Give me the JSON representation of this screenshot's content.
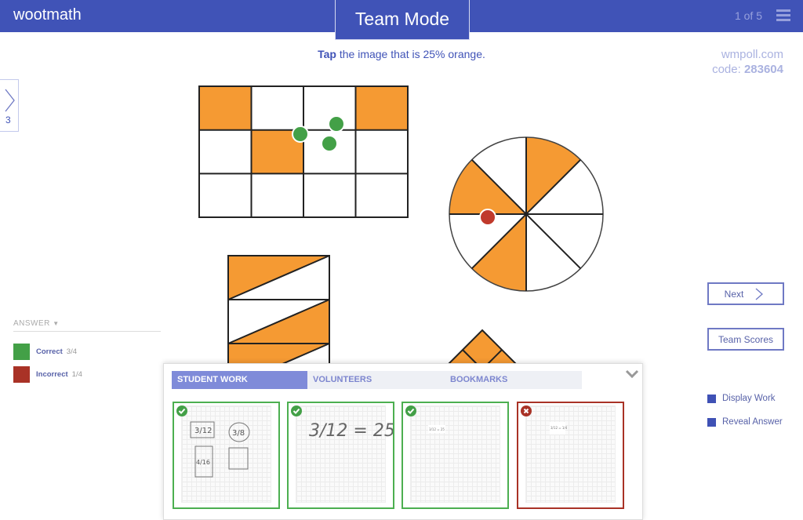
{
  "header": {
    "logo": "wootmath",
    "mode": "Team Mode",
    "pager": "1 of 5",
    "menu_icon": "hamburger-icon"
  },
  "prompt": {
    "bold": "Tap",
    "rest": " the image that is 25% orange."
  },
  "poll": {
    "site": "wmpoll.com",
    "code_label": "code: ",
    "code": "283604"
  },
  "sidetab": {
    "count": "3",
    "icon": "chevron-right-icon"
  },
  "answer": {
    "heading": "ANSWER",
    "items": [
      {
        "label": "Correct",
        "count": "3/4",
        "color": "#43a047"
      },
      {
        "label": "Incorrect",
        "count": "1/4",
        "color": "#a93226"
      }
    ]
  },
  "controls": {
    "next": "Next",
    "team_scores": "Team Scores",
    "display_work": "Display Work",
    "reveal_answer": "Reveal Answer"
  },
  "colors": {
    "header": "#4053b7",
    "orange": "#f59a33",
    "correct": "#4caf50",
    "incorrect": "#a93226"
  },
  "panel": {
    "tabs": [
      "STUDENT WORK",
      "VOLUNTEERS",
      "BOOKMARKS"
    ],
    "active_tab": "STUDENT WORK",
    "cards": [
      {
        "status": "correct",
        "work": [
          "3/12",
          "3/8",
          "4/16"
        ]
      },
      {
        "status": "correct",
        "work": [
          "3/12 = 25"
        ]
      },
      {
        "status": "correct",
        "work": [
          "3/12 = 25"
        ]
      },
      {
        "status": "incorrect",
        "work": [
          "3/12 = 1/4"
        ]
      }
    ]
  }
}
